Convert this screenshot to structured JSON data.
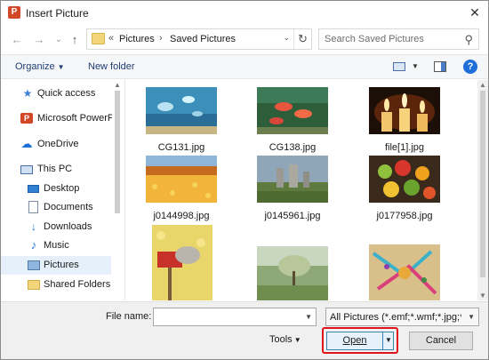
{
  "window": {
    "title": "Insert Picture",
    "close_glyph": "✕",
    "app_icon_letter": "P"
  },
  "navigation": {
    "back_glyph": "←",
    "forward_glyph": "→",
    "recent_glyph": "⌄",
    "up_glyph": "↑"
  },
  "address": {
    "overflow": "«",
    "crumbs": [
      "Pictures",
      "Saved Pictures"
    ],
    "separator": "›",
    "dropdown_glyph": "⌄",
    "refresh_glyph": "↻"
  },
  "search": {
    "placeholder": "Search Saved Pictures",
    "icon_glyph": "⚲"
  },
  "toolbar": {
    "organize_label": "Organize",
    "organize_caret": "▼",
    "new_folder_label": "New folder",
    "view_caret": "▼",
    "help_glyph": "?"
  },
  "sidebar": {
    "items": [
      {
        "label": "Quick access",
        "icon": "star-icon"
      },
      {
        "label": "Microsoft PowerP",
        "icon": "powerpoint-icon"
      },
      {
        "label": "OneDrive",
        "icon": "cloud-icon"
      },
      {
        "label": "This PC",
        "icon": "computer-icon"
      },
      {
        "label": "Desktop",
        "icon": "desktop-icon"
      },
      {
        "label": "Documents",
        "icon": "documents-icon"
      },
      {
        "label": "Downloads",
        "icon": "downloads-icon"
      },
      {
        "label": "Music",
        "icon": "music-icon"
      },
      {
        "label": "Pictures",
        "icon": "pictures-icon",
        "selected": true
      },
      {
        "label": "Shared Folders",
        "icon": "shared-folder-icon"
      }
    ]
  },
  "files": [
    {
      "name": "CG131.jpg"
    },
    {
      "name": "CG138.jpg"
    },
    {
      "name": "file[1].jpg"
    },
    {
      "name": "j0144998.jpg"
    },
    {
      "name": "j0145961.jpg"
    },
    {
      "name": "j0177958.jpg"
    },
    {
      "name": ""
    },
    {
      "name": ""
    },
    {
      "name": ""
    }
  ],
  "footer": {
    "file_name_label": "File name:",
    "file_name_value": "",
    "filter_value": "All Pictures (*.emf;*.wmf;*.jpg;*",
    "tools_label": "Tools",
    "tools_caret": "▼",
    "open_label": "Open",
    "open_caret": "▼",
    "cancel_label": "Cancel",
    "dropdown_glyph": "▼"
  },
  "colors": {
    "accent": "#1e6fd9",
    "highlight_border": "#e0141c",
    "selected_nav": "#e5f0fb"
  }
}
